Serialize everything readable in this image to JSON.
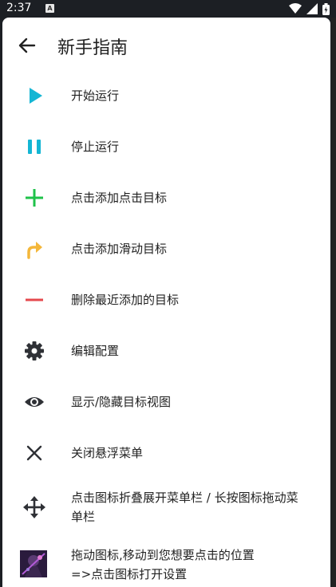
{
  "status_bar": {
    "time": "2:37",
    "a_badge": "A"
  },
  "header": {
    "title": "新手指南"
  },
  "items": [
    {
      "label": "开始运行",
      "icon": "play-icon",
      "color": "#14b6d4"
    },
    {
      "label": "停止运行",
      "icon": "pause-icon",
      "color": "#14b6d4"
    },
    {
      "label": "点击添加点击目标",
      "icon": "plus-icon",
      "color": "#1fc24a"
    },
    {
      "label": "点击添加滑动目标",
      "icon": "swipe-arrow-icon",
      "color": "#f4b73a"
    },
    {
      "label": "删除最近添加的目标",
      "icon": "minus-icon",
      "color": "#e5484d"
    },
    {
      "label": "编辑配置",
      "icon": "gear-icon",
      "color": "#2f3136"
    },
    {
      "label": "显示/隐藏目标视图",
      "icon": "eye-icon",
      "color": "#2f3136"
    },
    {
      "label": "关闭悬浮菜单",
      "icon": "close-icon",
      "color": "#2f3136"
    },
    {
      "label_line1": "点击图标折叠展开菜单栏 / 长按图标拖动菜",
      "label_line2": "单栏",
      "icon": "move-icon",
      "color": "#2f3136"
    },
    {
      "label_line1": "拖动图标,移动到您想要点击的位置",
      "label_line2": "=>点击图标打开设置",
      "icon": "app-avatar-icon"
    }
  ]
}
